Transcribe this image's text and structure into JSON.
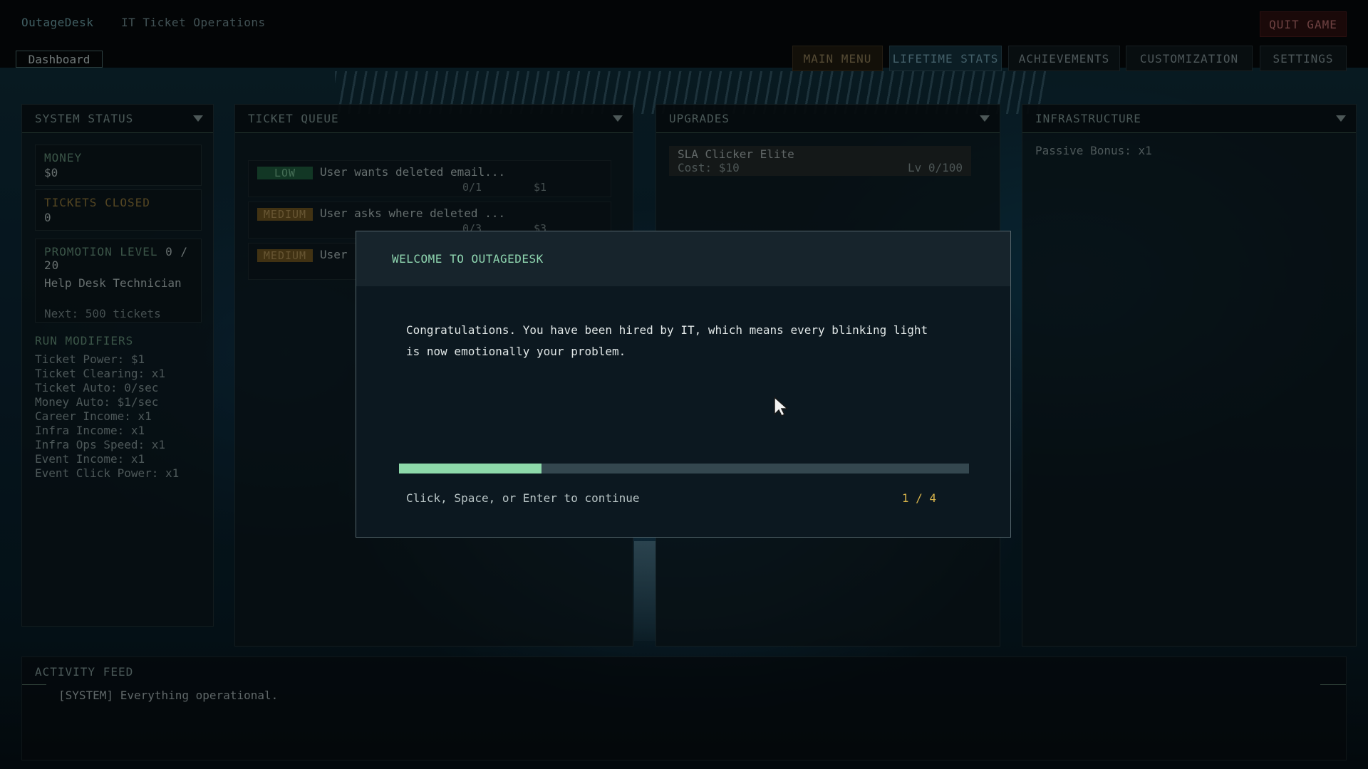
{
  "app": {
    "brand": "OutageDesk",
    "subtitle": "IT Ticket Operations",
    "dashboard_tab": "Dashboard",
    "quit_label": "QUIT GAME"
  },
  "nav": {
    "main_menu": "MAIN MENU",
    "lifetime_stats": "LIFETIME STATS",
    "achievements": "ACHIEVEMENTS",
    "customization": "CUSTOMIZATION",
    "settings": "SETTINGS"
  },
  "system_status": {
    "title": "SYSTEM STATUS",
    "money_label": "MONEY",
    "money_value": "$0",
    "tickets_label": "TICKETS CLOSED",
    "tickets_value": "0",
    "promotion_label": "PROMOTION LEVEL",
    "promotion_value": "0 / 20",
    "rank": "Help Desk Technician",
    "next": "Next: 500 tickets",
    "modifiers_title": "RUN MODIFIERS",
    "modifiers": [
      "Ticket Power: $1",
      "Ticket Clearing: x1",
      "Ticket Auto: 0/sec",
      "Money Auto: $1/sec",
      "Career Income: x1",
      "Infra Income: x1",
      "Infra Ops Speed: x1",
      "Event Income: x1",
      "Event Click Power: x1"
    ]
  },
  "ticket_queue": {
    "title": "TICKET QUEUE",
    "tickets": [
      {
        "priority": "LOW",
        "text": "User wants deleted email...",
        "progress": "0/1",
        "payout": "$1"
      },
      {
        "priority": "MEDIUM",
        "text": "User asks where deleted ...",
        "progress": "0/3",
        "payout": "$3"
      },
      {
        "priority": "MEDIUM",
        "text": "User",
        "progress": "",
        "payout": ""
      }
    ]
  },
  "upgrades": {
    "title": "UPGRADES",
    "items": [
      {
        "name": "SLA Clicker Elite",
        "cost": "Cost: $10",
        "level": "Lv 0/100"
      }
    ]
  },
  "infrastructure": {
    "title": "INFRASTRUCTURE",
    "passive_bonus": "Passive Bonus: x1"
  },
  "activity_feed": {
    "title": "ACTIVITY FEED",
    "entries": [
      "[SYSTEM] Everything operational."
    ]
  },
  "modal": {
    "title": "WELCOME TO OUTAGEDESK",
    "body_line1": "Congratulations. You have been hired by IT, which means every blinking light",
    "body_line2": "is now emotionally your problem.",
    "hint": "Click, Space, or Enter to continue",
    "step": "1 / 4",
    "progress_fraction": 0.25
  },
  "icons": {
    "panel_toggle": "chevron-down-icon",
    "cursor": "mouse-pointer-icon"
  },
  "colors": {
    "accent_green": "#8ed9aa",
    "step_amber": "#d6b24a",
    "quit_red": "#b06a6a"
  }
}
